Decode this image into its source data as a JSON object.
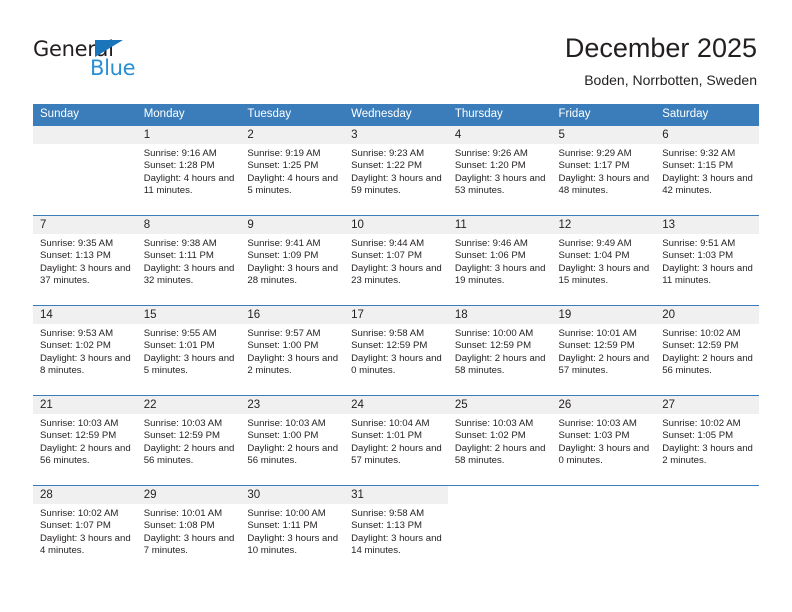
{
  "brand": {
    "name_part1": "General",
    "name_part2": "Blue",
    "triangle_color": "#1b75bb",
    "blue_color": "#2b8fd4"
  },
  "header": {
    "title": "December 2025",
    "subtitle": "Boden, Norrbotten, Sweden"
  },
  "theme": {
    "header_blue": "#3a7dba",
    "band_gray": "#f0f0f0",
    "text": "#231f20"
  },
  "weekdays": [
    "Sunday",
    "Monday",
    "Tuesday",
    "Wednesday",
    "Thursday",
    "Friday",
    "Saturday"
  ],
  "labels": {
    "sunrise_prefix": "Sunrise:",
    "sunset_prefix": "Sunset:",
    "daylight_prefix": "Daylight:"
  },
  "weeks": [
    [
      {
        "day": "",
        "empty": true,
        "sunrise": "",
        "sunset": "",
        "daylight": ""
      },
      {
        "day": "1",
        "sunrise": "Sunrise: 9:16 AM",
        "sunset": "Sunset: 1:28 PM",
        "daylight": "Daylight: 4 hours and 11 minutes."
      },
      {
        "day": "2",
        "sunrise": "Sunrise: 9:19 AM",
        "sunset": "Sunset: 1:25 PM",
        "daylight": "Daylight: 4 hours and 5 minutes."
      },
      {
        "day": "3",
        "sunrise": "Sunrise: 9:23 AM",
        "sunset": "Sunset: 1:22 PM",
        "daylight": "Daylight: 3 hours and 59 minutes."
      },
      {
        "day": "4",
        "sunrise": "Sunrise: 9:26 AM",
        "sunset": "Sunset: 1:20 PM",
        "daylight": "Daylight: 3 hours and 53 minutes."
      },
      {
        "day": "5",
        "sunrise": "Sunrise: 9:29 AM",
        "sunset": "Sunset: 1:17 PM",
        "daylight": "Daylight: 3 hours and 48 minutes."
      },
      {
        "day": "6",
        "sunrise": "Sunrise: 9:32 AM",
        "sunset": "Sunset: 1:15 PM",
        "daylight": "Daylight: 3 hours and 42 minutes."
      }
    ],
    [
      {
        "day": "7",
        "sunrise": "Sunrise: 9:35 AM",
        "sunset": "Sunset: 1:13 PM",
        "daylight": "Daylight: 3 hours and 37 minutes."
      },
      {
        "day": "8",
        "sunrise": "Sunrise: 9:38 AM",
        "sunset": "Sunset: 1:11 PM",
        "daylight": "Daylight: 3 hours and 32 minutes."
      },
      {
        "day": "9",
        "sunrise": "Sunrise: 9:41 AM",
        "sunset": "Sunset: 1:09 PM",
        "daylight": "Daylight: 3 hours and 28 minutes."
      },
      {
        "day": "10",
        "sunrise": "Sunrise: 9:44 AM",
        "sunset": "Sunset: 1:07 PM",
        "daylight": "Daylight: 3 hours and 23 minutes."
      },
      {
        "day": "11",
        "sunrise": "Sunrise: 9:46 AM",
        "sunset": "Sunset: 1:06 PM",
        "daylight": "Daylight: 3 hours and 19 minutes."
      },
      {
        "day": "12",
        "sunrise": "Sunrise: 9:49 AM",
        "sunset": "Sunset: 1:04 PM",
        "daylight": "Daylight: 3 hours and 15 minutes."
      },
      {
        "day": "13",
        "sunrise": "Sunrise: 9:51 AM",
        "sunset": "Sunset: 1:03 PM",
        "daylight": "Daylight: 3 hours and 11 minutes."
      }
    ],
    [
      {
        "day": "14",
        "sunrise": "Sunrise: 9:53 AM",
        "sunset": "Sunset: 1:02 PM",
        "daylight": "Daylight: 3 hours and 8 minutes."
      },
      {
        "day": "15",
        "sunrise": "Sunrise: 9:55 AM",
        "sunset": "Sunset: 1:01 PM",
        "daylight": "Daylight: 3 hours and 5 minutes."
      },
      {
        "day": "16",
        "sunrise": "Sunrise: 9:57 AM",
        "sunset": "Sunset: 1:00 PM",
        "daylight": "Daylight: 3 hours and 2 minutes."
      },
      {
        "day": "17",
        "sunrise": "Sunrise: 9:58 AM",
        "sunset": "Sunset: 12:59 PM",
        "daylight": "Daylight: 3 hours and 0 minutes."
      },
      {
        "day": "18",
        "sunrise": "Sunrise: 10:00 AM",
        "sunset": "Sunset: 12:59 PM",
        "daylight": "Daylight: 2 hours and 58 minutes."
      },
      {
        "day": "19",
        "sunrise": "Sunrise: 10:01 AM",
        "sunset": "Sunset: 12:59 PM",
        "daylight": "Daylight: 2 hours and 57 minutes."
      },
      {
        "day": "20",
        "sunrise": "Sunrise: 10:02 AM",
        "sunset": "Sunset: 12:59 PM",
        "daylight": "Daylight: 2 hours and 56 minutes."
      }
    ],
    [
      {
        "day": "21",
        "sunrise": "Sunrise: 10:03 AM",
        "sunset": "Sunset: 12:59 PM",
        "daylight": "Daylight: 2 hours and 56 minutes."
      },
      {
        "day": "22",
        "sunrise": "Sunrise: 10:03 AM",
        "sunset": "Sunset: 12:59 PM",
        "daylight": "Daylight: 2 hours and 56 minutes."
      },
      {
        "day": "23",
        "sunrise": "Sunrise: 10:03 AM",
        "sunset": "Sunset: 1:00 PM",
        "daylight": "Daylight: 2 hours and 56 minutes."
      },
      {
        "day": "24",
        "sunrise": "Sunrise: 10:04 AM",
        "sunset": "Sunset: 1:01 PM",
        "daylight": "Daylight: 2 hours and 57 minutes."
      },
      {
        "day": "25",
        "sunrise": "Sunrise: 10:03 AM",
        "sunset": "Sunset: 1:02 PM",
        "daylight": "Daylight: 2 hours and 58 minutes."
      },
      {
        "day": "26",
        "sunrise": "Sunrise: 10:03 AM",
        "sunset": "Sunset: 1:03 PM",
        "daylight": "Daylight: 3 hours and 0 minutes."
      },
      {
        "day": "27",
        "sunrise": "Sunrise: 10:02 AM",
        "sunset": "Sunset: 1:05 PM",
        "daylight": "Daylight: 3 hours and 2 minutes."
      }
    ],
    [
      {
        "day": "28",
        "sunrise": "Sunrise: 10:02 AM",
        "sunset": "Sunset: 1:07 PM",
        "daylight": "Daylight: 3 hours and 4 minutes."
      },
      {
        "day": "29",
        "sunrise": "Sunrise: 10:01 AM",
        "sunset": "Sunset: 1:08 PM",
        "daylight": "Daylight: 3 hours and 7 minutes."
      },
      {
        "day": "30",
        "sunrise": "Sunrise: 10:00 AM",
        "sunset": "Sunset: 1:11 PM",
        "daylight": "Daylight: 3 hours and 10 minutes."
      },
      {
        "day": "31",
        "sunrise": "Sunrise: 9:58 AM",
        "sunset": "Sunset: 1:13 PM",
        "daylight": "Daylight: 3 hours and 14 minutes."
      },
      {
        "day": "",
        "blank": true,
        "sunrise": "",
        "sunset": "",
        "daylight": ""
      },
      {
        "day": "",
        "blank": true,
        "sunrise": "",
        "sunset": "",
        "daylight": ""
      },
      {
        "day": "",
        "blank": true,
        "sunrise": "",
        "sunset": "",
        "daylight": ""
      }
    ]
  ]
}
